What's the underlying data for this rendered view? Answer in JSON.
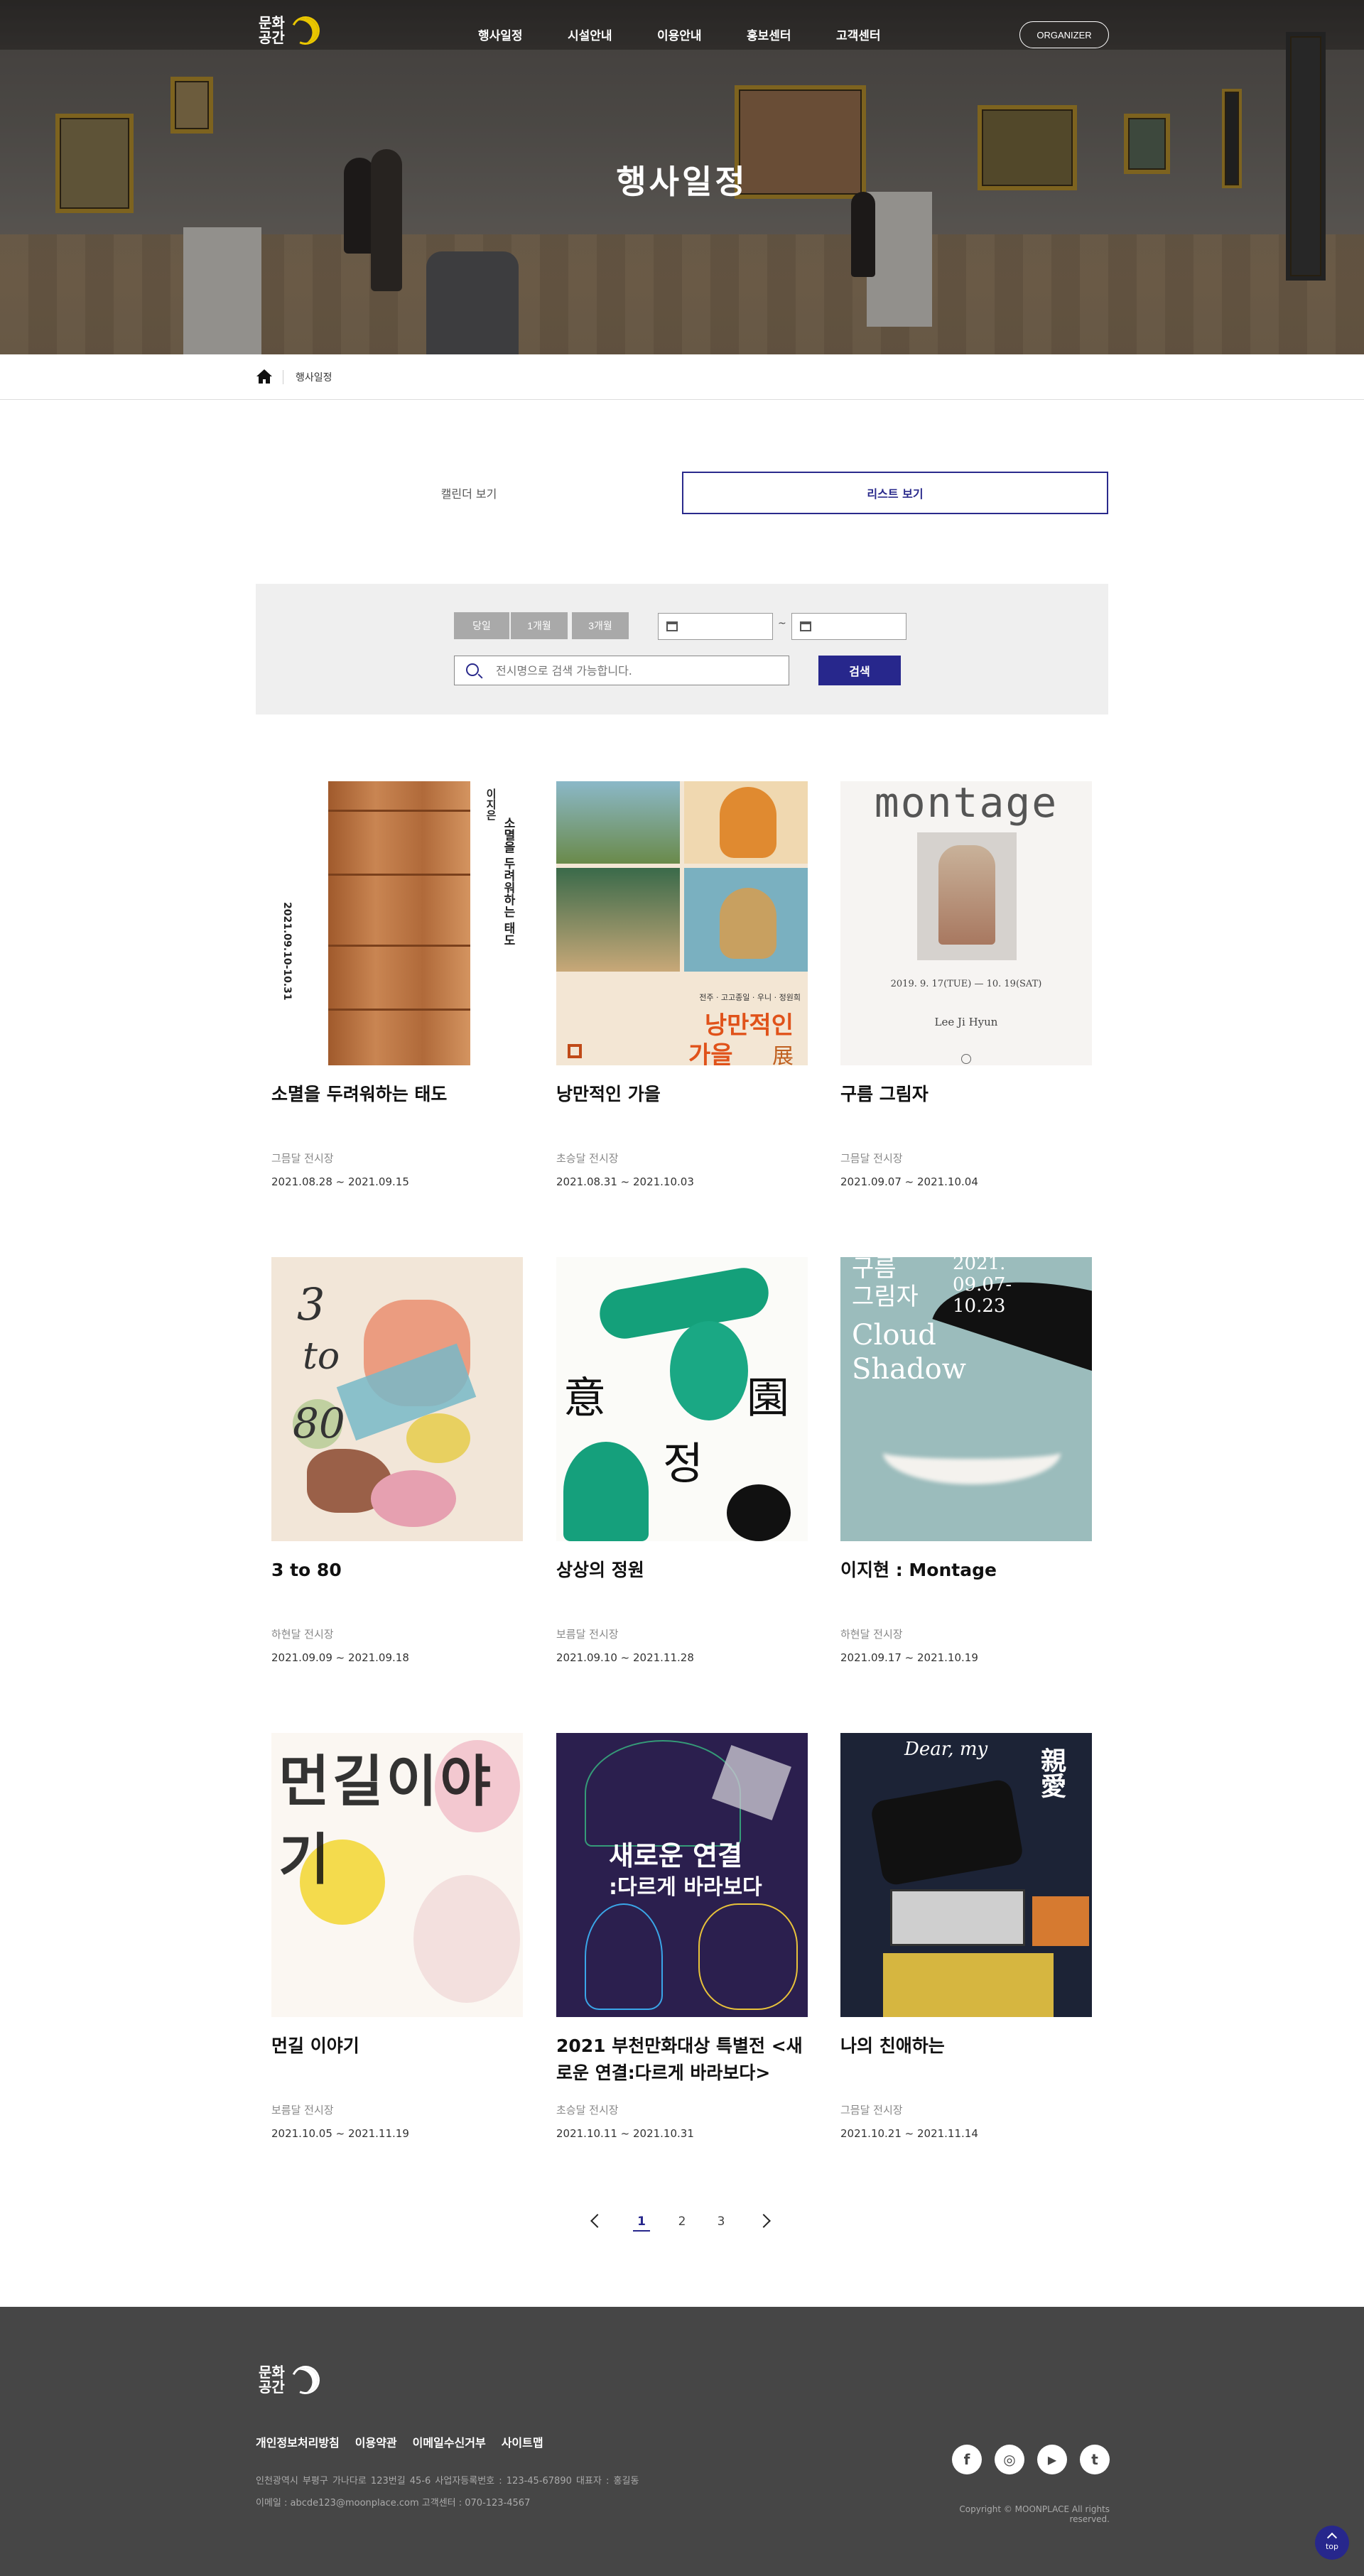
{
  "header": {
    "logo_text": "문화공간",
    "nav": [
      "행사일정",
      "시설안내",
      "이용안내",
      "홍보센터",
      "고객센터"
    ],
    "organizer": "ORGANIZER",
    "hero_title": "행사일정"
  },
  "breadcrumb": {
    "current": "행사일정"
  },
  "view_tabs": {
    "calendar": "캘린더 보기",
    "list": "리스트 보기"
  },
  "filter": {
    "period_buttons": [
      "당일",
      "1개월",
      "3개월"
    ],
    "range_separator": "~",
    "start_date": "",
    "end_date": "",
    "search_placeholder": "전시명으로 검색 가능합니다.",
    "search_button": "검색"
  },
  "events": [
    {
      "title": "소멸을 두려워하는 태도",
      "venue": "그믐달 전시장",
      "period": "2021.08.28 ~ 2021.09.15"
    },
    {
      "title": "낭만적인 가을",
      "venue": "초승달 전시장",
      "period": "2021.08.31 ~ 2021.10.03"
    },
    {
      "title": "구름 그림자",
      "venue": "그믐달 전시장",
      "period": "2021.09.07 ~ 2021.10.04"
    },
    {
      "title": "3 to 80",
      "venue": "하현달 전시장",
      "period": "2021.09.09 ~ 2021.09.18"
    },
    {
      "title": "상상의 정원",
      "venue": "보름달 전시장",
      "period": "2021.09.10 ~ 2021.11.28"
    },
    {
      "title": "이지현 : Montage",
      "venue": "하현달 전시장",
      "period": "2021.09.17 ~ 2021.10.19"
    },
    {
      "title": "먼길 이야기",
      "venue": "보름달 전시장",
      "period": "2021.10.05 ~ 2021.11.19"
    },
    {
      "title": "2021 부천만화대상 특별전 <새로운 연결:다르게 바라보다>",
      "venue": "초승달 전시장",
      "period": "2021.10.11 ~ 2021.10.31"
    },
    {
      "title": "나의 친애하는",
      "venue": "그믐달 전시장",
      "period": "2021.10.21 ~ 2021.11.14"
    }
  ],
  "posters": {
    "p1": {
      "artist": "이지은",
      "title": "소멸을 두려워하는 태도",
      "date": "2021.09.10-10.31"
    },
    "p2": {
      "title_line1": "낭만적인",
      "title_line2": "가을",
      "suffix": "展",
      "names": "전주 · 고고종일 · 우니 · 정원희"
    },
    "p3": {
      "heading": "montage",
      "dates": "2019. 9. 17(TUE) — 10. 19(SAT)",
      "artist": "Lee Ji Hyun"
    },
    "p4": {
      "heading_a": "3",
      "heading_b": "to",
      "heading_c": "80"
    },
    "p5": {
      "char1": "意",
      "char2": "園",
      "char3": "정"
    },
    "p6": {
      "kr_line1": "구름",
      "kr_line2": "그림자",
      "en_line1": "Cloud",
      "en_line2": "Shadow",
      "date1": "2021.",
      "date2": "09.07-",
      "date3": "10.23"
    },
    "p7": {
      "heading": "먼길이야기"
    },
    "p8": {
      "line1": "새로운 연결",
      "line2": ":다르게 바라보다"
    },
    "p9": {
      "heading": "Dear, my",
      "hanja": "親愛"
    }
  },
  "pagination": {
    "pages": [
      "1",
      "2",
      "3"
    ],
    "current": "1"
  },
  "footer": {
    "logo_text": "문화공간",
    "links": [
      "개인정보처리방침",
      "이용약관",
      "이메일수신거부",
      "사이트맵"
    ],
    "address": "인천광역시 부평구 가나다로 123번길 45-6    사업자등록번호 : 123-45-67890    대표자 : 홍길동",
    "contact": "이메일 : abcde123@moonplace.com    고객센터 : 070-123-4567",
    "copyright": "Copyright © MOONPLACE All rights reserved.",
    "sns": [
      "f",
      "◎",
      "▶",
      "t"
    ],
    "top_label": "top"
  },
  "colors": {
    "accent": "#27278c",
    "logo_yellow": "#e9c600",
    "footer_bg": "#464646"
  }
}
